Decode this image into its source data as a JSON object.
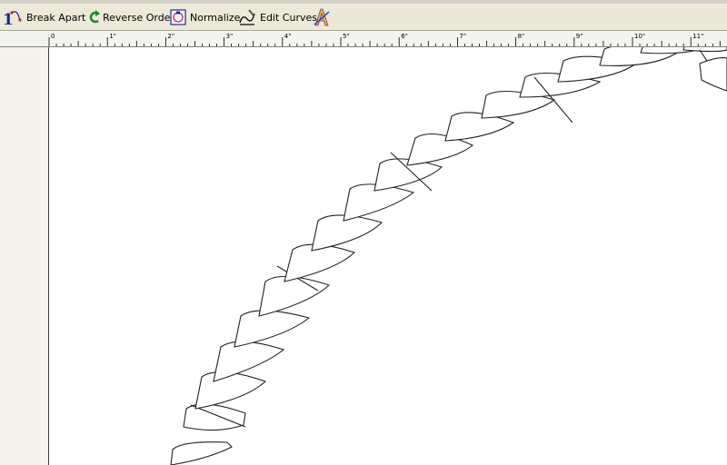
{
  "toolbar": {
    "break_apart": "Break Apart",
    "reverse_order": "Reverse Order",
    "normalize": "Normalize",
    "edit_curves": "Edit Curves"
  },
  "ruler": {
    "labels": [
      "0",
      "1\"",
      "2\"",
      "3\"",
      "4\"",
      "5\"",
      "6\"",
      "7\"",
      "8\"",
      "9\"",
      "10\"",
      "11\""
    ]
  }
}
